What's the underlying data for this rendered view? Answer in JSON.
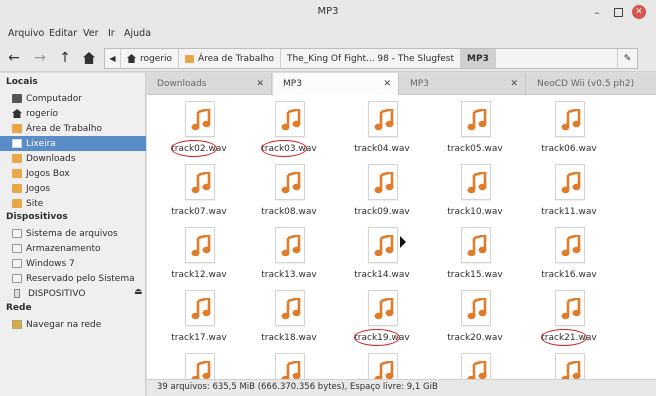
{
  "window": {
    "title": "MP3"
  },
  "menu": [
    "Arquivo",
    "Editar",
    "Ver",
    "Ir",
    "Ajuda"
  ],
  "pathbar": {
    "crumbs": [
      "rogerio",
      "Área de Trabalho",
      "The_King Of Fight... 98 - The Slugfest",
      "MP3"
    ],
    "active": "MP3"
  },
  "sidebar": {
    "sections": [
      {
        "title": "Locais",
        "items": [
          "Computador",
          "rogerio",
          "Área de Trabalho",
          "Lixeira",
          "Downloads",
          "Jogos Box",
          "Jogos",
          "Site"
        ]
      },
      {
        "title": "Dispositivos",
        "items": [
          "Sistema de arquivos",
          "Armazenamento",
          "Windows 7",
          "Reservado pelo Sistema",
          "DISPOSITIVO"
        ]
      },
      {
        "title": "Rede",
        "items": [
          "Navegar na rede"
        ]
      }
    ],
    "selected": "Lixeira"
  },
  "tabs": [
    "Downloads",
    "MP3",
    "MP3",
    "NeoCD Wii (v0.5 ph2)"
  ],
  "active_tab_index": 1,
  "files": [
    "track02.wav",
    "track03.wav",
    "track04.wav",
    "track05.wav",
    "track06.wav",
    "track07.wav",
    "track08.wav",
    "track09.wav",
    "track10.wav",
    "track11.wav",
    "track12.wav",
    "track13.wav",
    "track14.wav",
    "track15.wav",
    "track16.wav",
    "track17.wav",
    "track18.wav",
    "track19.wav",
    "track20.wav",
    "track21.wav"
  ],
  "highlighted_files": [
    "track02.wav",
    "track03.wav",
    "track19.wav",
    "track21.wav"
  ],
  "colors": {
    "accent": "#5a8cc8",
    "music_icon": "#e07b2a",
    "annotation": "#d0262a"
  },
  "status": "39 arquivos: 635,5 MiB (666.370.356 bytes), Espaço livre: 9,1 GiB"
}
